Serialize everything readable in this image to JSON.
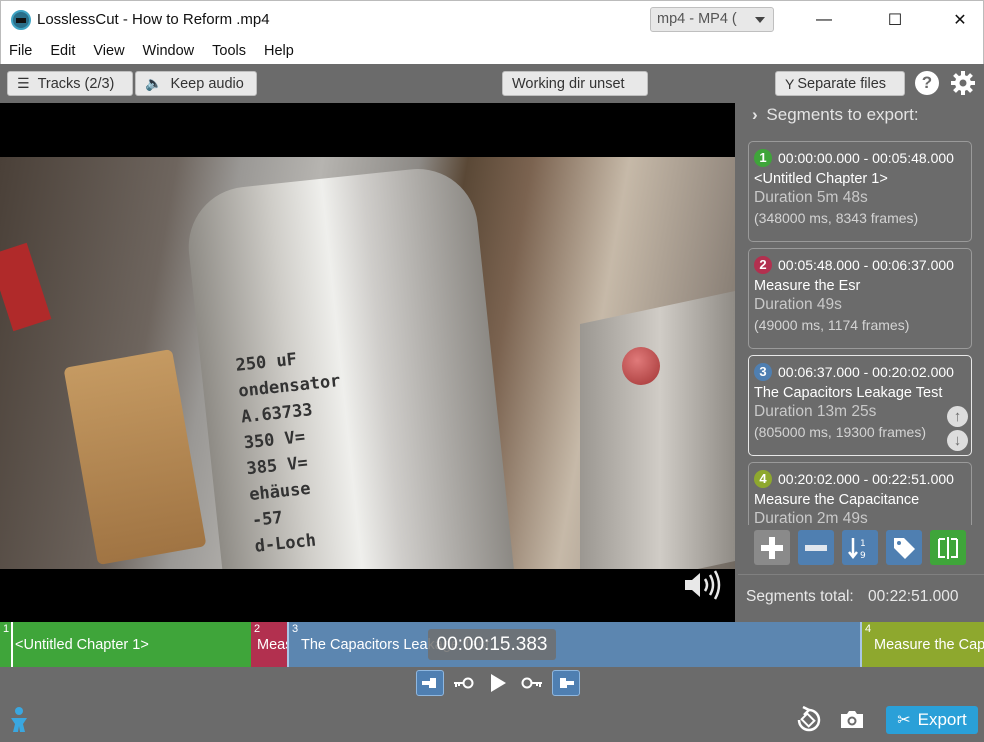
{
  "window": {
    "title": "LosslessCut - How to Reform .mp4",
    "minimize": "—",
    "maximize": "☐",
    "close": "✕"
  },
  "menu": [
    "File",
    "Edit",
    "View",
    "Window",
    "Tools",
    "Help"
  ],
  "toolbar": {
    "tracks_label": "Tracks (2/3)",
    "keep_audio_label": "Keep audio",
    "working_dir_label": "Working dir unset",
    "format_selected": "mp4 - MP4 (",
    "separate_files_label": "Separate files",
    "help_label": "?"
  },
  "video": {
    "capacitor_text": [
      "250 uF",
      "ondensator",
      "A.63733",
      "350 V=",
      "385 V=",
      "ehäuse",
      "-57",
      "d-Loch"
    ]
  },
  "sidebar": {
    "header": "Segments to export:",
    "segments": [
      {
        "num": "1",
        "color": "#3fa53a",
        "range": "00:00:00.000 - 00:05:48.000",
        "name": "<Untitled Chapter 1>",
        "duration": "Duration 5m 48s",
        "details": "(348000 ms, 8343 frames)"
      },
      {
        "num": "2",
        "color": "#b2304f",
        "range": "00:05:48.000 - 00:06:37.000",
        "name": "Measure the Esr",
        "duration": "Duration 49s",
        "details": "(49000 ms, 1174 frames)"
      },
      {
        "num": "3",
        "color": "#4f7fb1",
        "range": "00:06:37.000 - 00:20:02.000",
        "name": "The Capacitors Leakage Test",
        "duration": "Duration 13m 25s",
        "details": "(805000 ms, 19300 frames)"
      },
      {
        "num": "4",
        "color": "#8ea82e",
        "range": "00:20:02.000 - 00:22:51.000",
        "name": "Measure the Capacitance",
        "duration": "Duration 2m 49s",
        "details": ""
      }
    ],
    "total_label": "Segments total:",
    "total_value": "00:22:51.000"
  },
  "timeline": {
    "segments": [
      {
        "idx": "1",
        "label": "<Untitled Chapter 1>",
        "color": "#3fa53a"
      },
      {
        "idx": "2",
        "label": "Measure the Esr",
        "color": "#b2304f"
      },
      {
        "idx": "3",
        "label": "The Capacitors Leakage Test",
        "color": "#5c86b0"
      },
      {
        "idx": "4",
        "label": "Measure the Capacitance",
        "color": "#8ea82e"
      }
    ],
    "timecode": "00:00:15.383"
  },
  "bottom": {
    "export_label": "Export"
  },
  "colors": {
    "accent": "#2aa0d8",
    "background": "#6b6b6b"
  }
}
